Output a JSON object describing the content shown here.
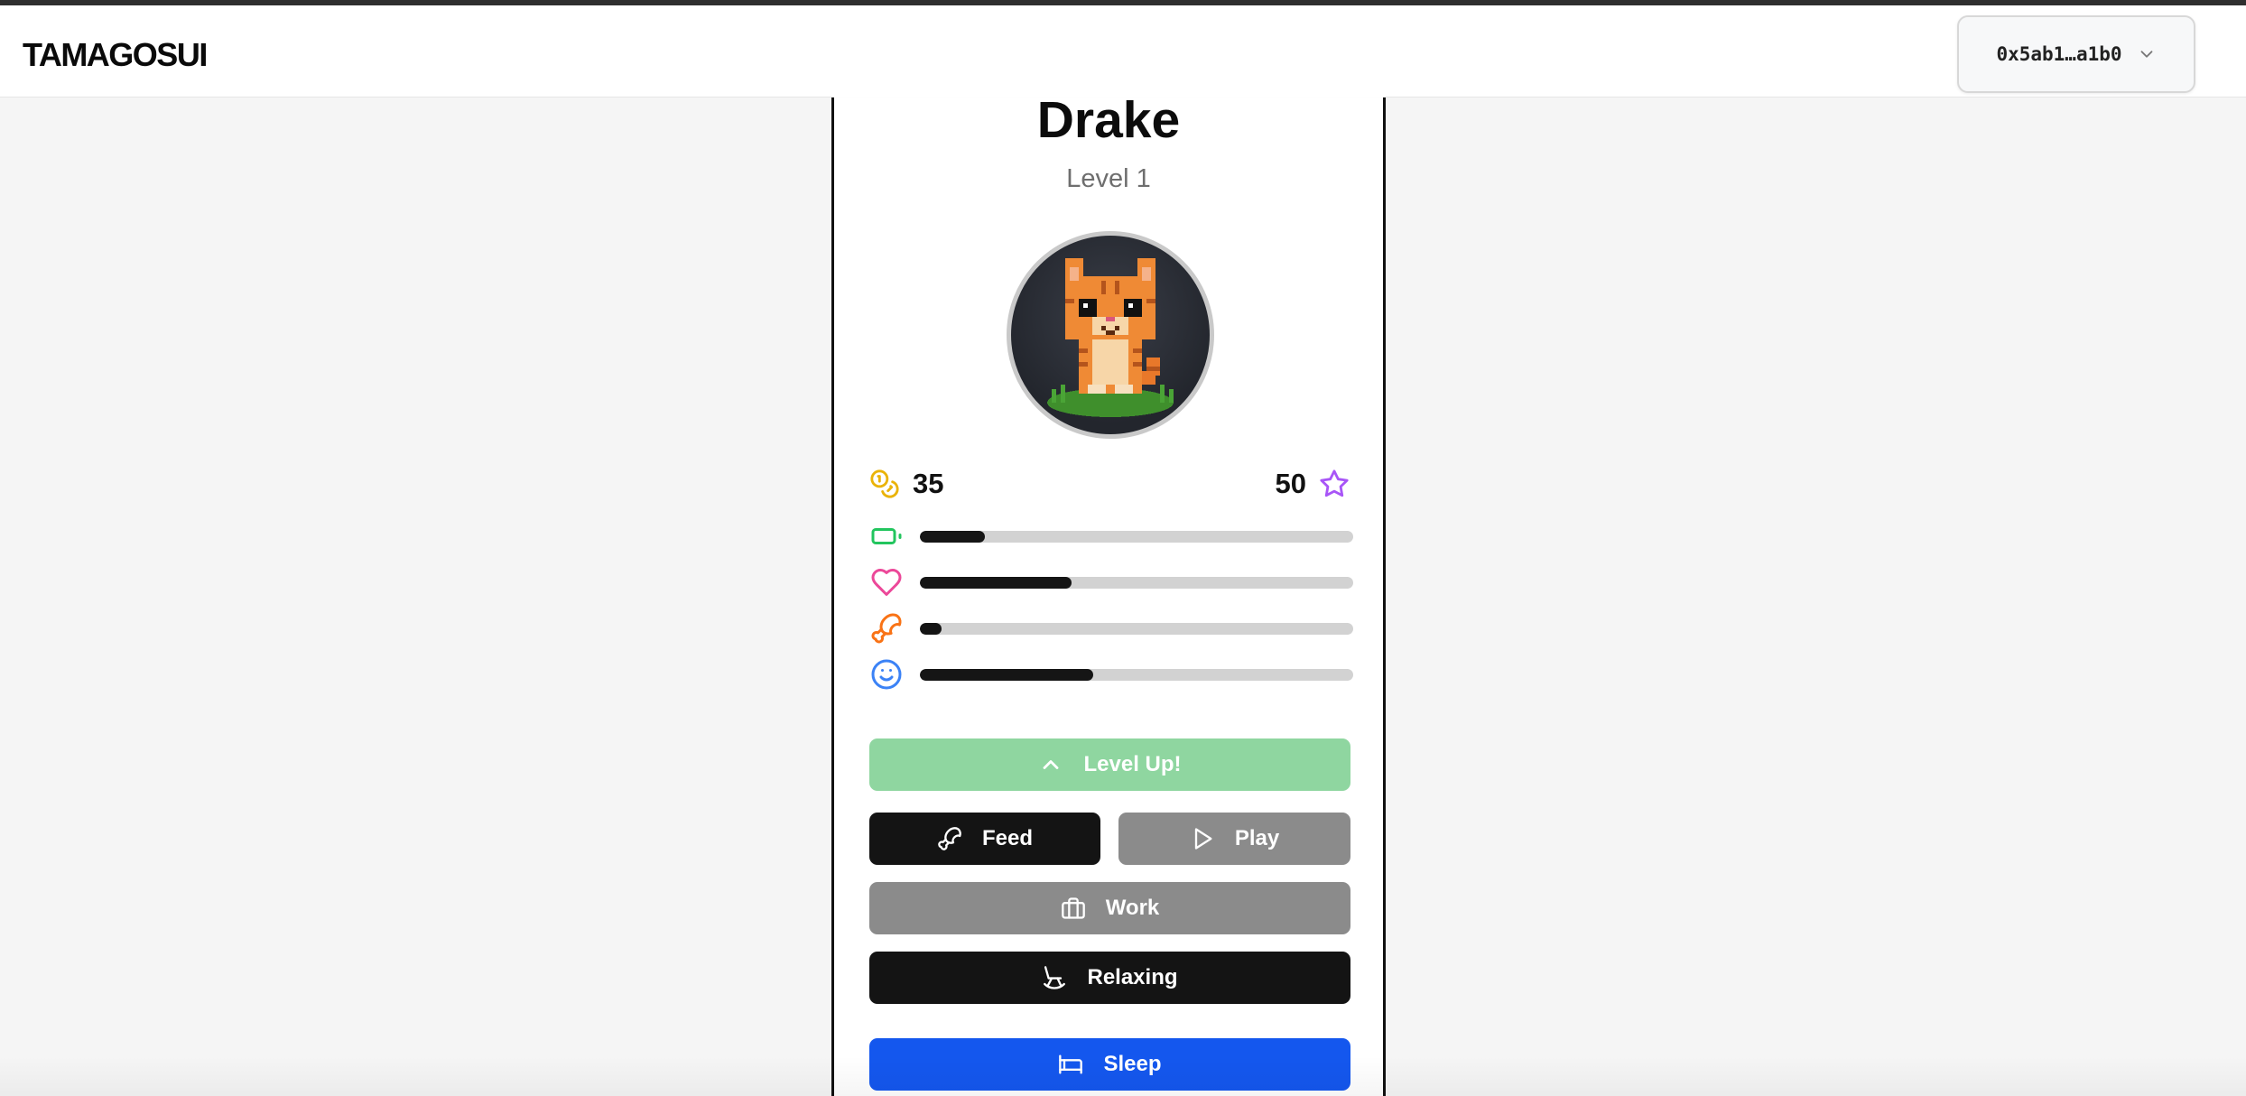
{
  "app": {
    "brand": "TAMAGOSUI"
  },
  "wallet": {
    "address": "0x5ab1…a1b0",
    "chevron_icon": "chevron-down-icon"
  },
  "pet": {
    "name": "Drake",
    "level_label": "Level 1",
    "avatar_icon": "pixel-cat-avatar",
    "coins": "35",
    "coins_icon": "coins-icon",
    "experience": "50",
    "experience_icon": "star-icon"
  },
  "stats": [
    {
      "name": "energy",
      "icon": "battery-icon",
      "color": "#22c55e",
      "fraction": 0.15
    },
    {
      "name": "happiness",
      "icon": "heart-icon",
      "color": "#ec4899",
      "fraction": 0.35
    },
    {
      "name": "hunger",
      "icon": "drumstick-icon",
      "color": "#f97316",
      "fraction": 0.05
    },
    {
      "name": "mood",
      "icon": "smile-icon",
      "color": "#3b82f6",
      "fraction": 0.4
    }
  ],
  "actions": {
    "level_up": "Level Up!",
    "feed": "Feed",
    "play": "Play",
    "work": "Work",
    "relax": "Relaxing",
    "sleep": "Sleep"
  },
  "colors": {
    "level_up_bg": "#8fd6a0",
    "primary_dark": "#141414",
    "disabled_gray": "#8b8b8b",
    "sleep_blue": "#1457ee",
    "coins_color": "#eab308",
    "star_color": "#a855f7"
  }
}
